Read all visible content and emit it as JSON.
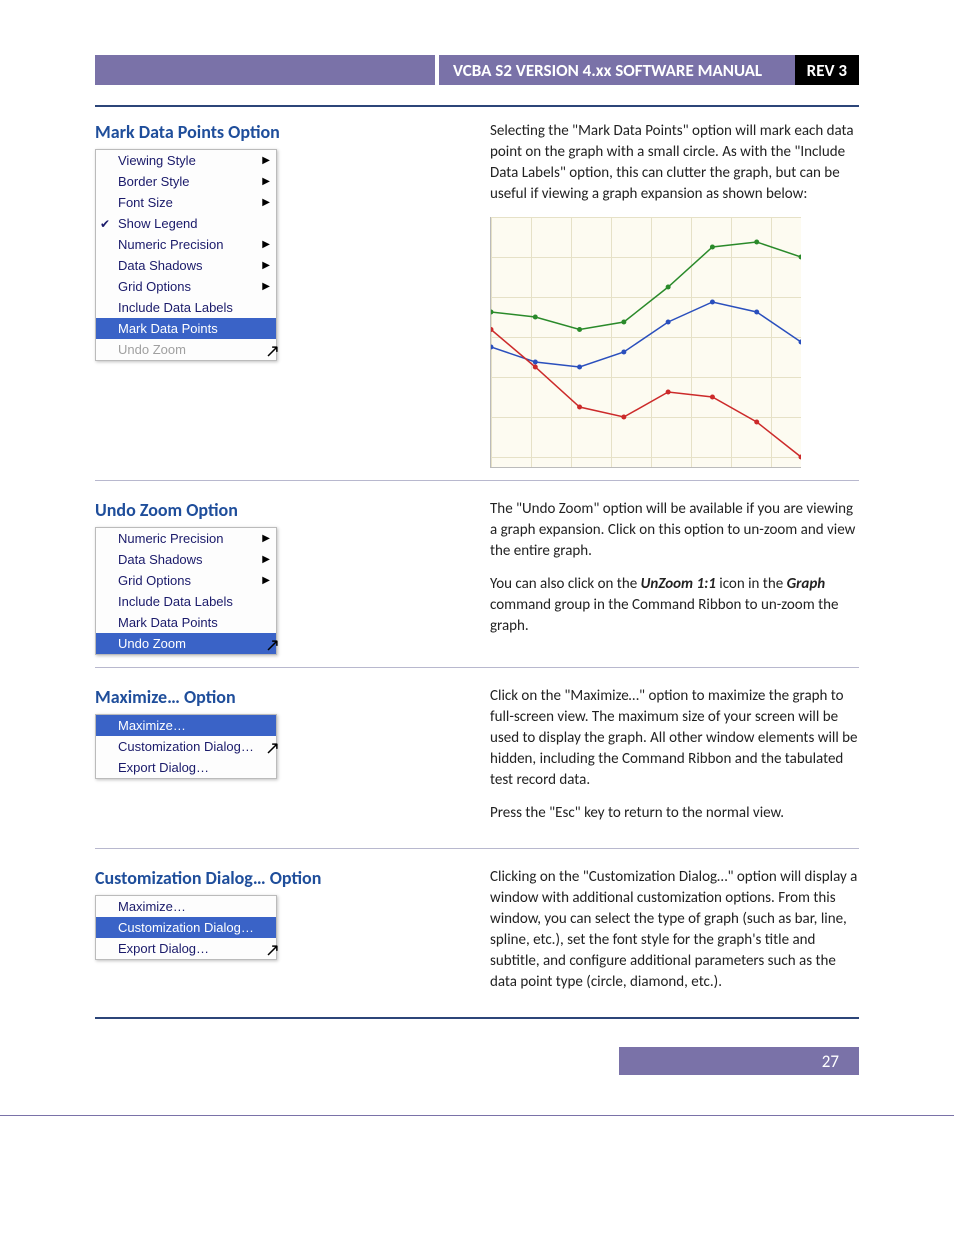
{
  "header": {
    "title": "VCBA S2 VERSION 4.xx SOFTWARE MANUAL",
    "rev": "REV 3"
  },
  "footer": {
    "page": "27"
  },
  "sections": {
    "mark": {
      "title": "Mark Data Points Option",
      "menu": [
        "Viewing Style",
        "Border Style",
        "Font Size",
        "Show Legend",
        "Numeric Precision",
        "Data Shadows",
        "Grid Options",
        "Include Data Labels",
        "Mark Data Points",
        "Undo Zoom"
      ],
      "text1": "Selecting the \"Mark Data Points\" option will mark each data point on the graph with a small circle. As with the \"Include Data Labels\" option, this can clutter the graph, but can be useful if viewing a graph expansion as shown below:"
    },
    "undo": {
      "title": "Undo Zoom Option",
      "menu": [
        "Numeric Precision",
        "Data Shadows",
        "Grid Options",
        "Include Data Labels",
        "Mark Data Points",
        "Undo Zoom"
      ],
      "text1": "The \"Undo Zoom\" option will be available if you are viewing a graph expansion. Click on this option to un-zoom and view the entire graph.",
      "text2a": "You can also click on the ",
      "text2b": "UnZoom 1:1",
      "text2c": " icon in the ",
      "text2d": "Graph",
      "text2e": " command group in the Command Ribbon to un-zoom the graph."
    },
    "max": {
      "title": "Maximize… Option",
      "menu": [
        "Maximize…",
        "Customization Dialog…",
        "Export Dialog…"
      ],
      "text1": "Click on the \"Maximize…\" option to maximize the graph to full-screen view. The maximum size of your screen will be used to display the graph. All other window elements will be hidden, including the Command Ribbon and the tabulated test record data.",
      "text2": "Press the \"Esc\" key to return to the normal view."
    },
    "cust": {
      "title": "Customization Dialog… Option",
      "menu": [
        "Maximize…",
        "Customization Dialog…",
        "Export Dialog…"
      ],
      "text1": "Clicking on the \"Customization Dialog…\" option will display a window with additional customization options. From this window, you can select the type of graph (such as bar, line, spline, etc.), set the font style for the graph's title and subtitle, and configure additional parameters such as the data point type (circle, diamond, etc.)."
    }
  },
  "chart_data": {
    "type": "line",
    "x": [
      0,
      1,
      2,
      3,
      4,
      5,
      6,
      7
    ],
    "series": [
      {
        "name": "green",
        "color": "#2a8a2a",
        "values": [
          62,
          60,
          55,
          58,
          72,
          88,
          90,
          84
        ]
      },
      {
        "name": "blue",
        "color": "#2a4fbd",
        "values": [
          48,
          42,
          40,
          46,
          58,
          66,
          62,
          50
        ]
      },
      {
        "name": "red",
        "color": "#cc2a2a",
        "values": [
          55,
          40,
          24,
          20,
          30,
          28,
          18,
          4
        ]
      }
    ],
    "ylim": [
      0,
      100
    ]
  }
}
